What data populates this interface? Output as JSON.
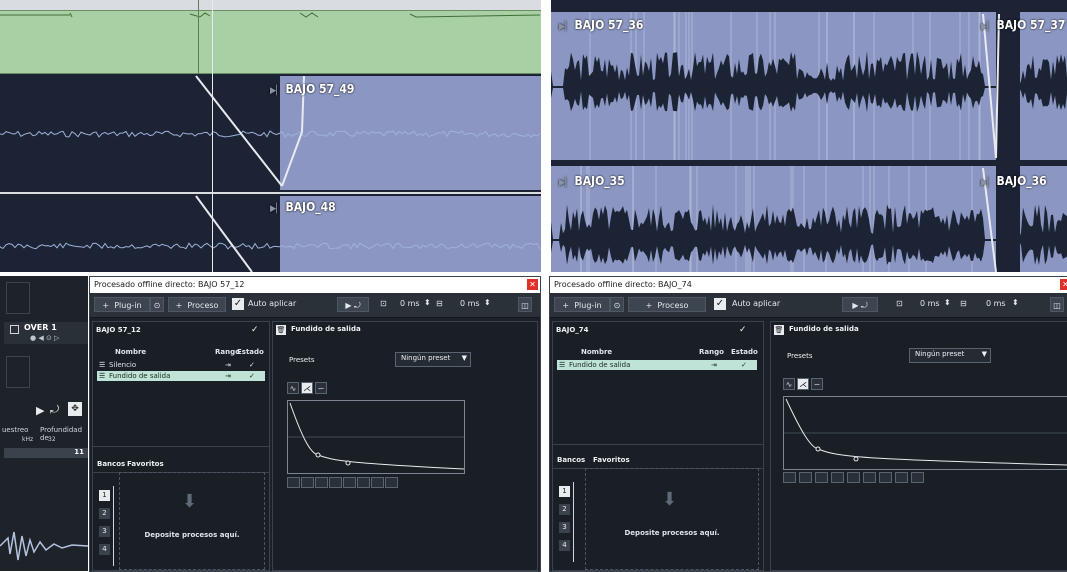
{
  "top_left": {
    "tracks": [
      {
        "label": "BAJO 57_49"
      },
      {
        "label": "BAJO_48"
      }
    ]
  },
  "top_right": {
    "tracks": [
      {
        "label": "BAJO 57_36"
      },
      {
        "label": "BAJO 57_37"
      },
      {
        "label": "BAJO_35"
      },
      {
        "label": "BAJO_36"
      }
    ]
  },
  "mixer_left": {
    "channel_name": "OVER 1",
    "col_headers": [
      "uestreo",
      "Profundidad de"
    ],
    "col_units": [
      "kHz",
      "32"
    ],
    "value": "11"
  },
  "dialogs": [
    {
      "title": "Procesado offline directo: BAJO 57_12",
      "toolbar": {
        "plugin_label": "Plug-in",
        "proceso_label": "Proceso",
        "auto_label": "Auto aplicar",
        "time1": "0 ms",
        "time2": "0 ms"
      },
      "clip_name": "BAJO 57_12",
      "list_headers": {
        "name": "Nombre",
        "range": "Rango",
        "state": "Estado"
      },
      "processes": [
        {
          "name": "Silencio",
          "state": "✓",
          "selected": false
        },
        {
          "name": "Fundido de salida",
          "state": "✓",
          "selected": true
        }
      ],
      "bank_tabs": [
        "Bancos",
        "Favoritos"
      ],
      "slots": [
        "1",
        "2",
        "3",
        "4"
      ],
      "drop_text": "Deposite procesos aquí.",
      "right_title": "Fundido de salida",
      "presets_label": "Presets",
      "preset_value": "Ningún preset"
    },
    {
      "title": "Procesado offline directo: BAJO_74",
      "toolbar": {
        "plugin_label": "Plug-in",
        "proceso_label": "Proceso",
        "auto_label": "Auto aplicar",
        "time1": "0 ms",
        "time2": "0 ms"
      },
      "clip_name": "BAJO_74",
      "list_headers": {
        "name": "Nombre",
        "range": "Rango",
        "state": "Estado"
      },
      "processes": [
        {
          "name": "Fundido de salida",
          "state": "✓",
          "selected": true
        }
      ],
      "bank_tabs": [
        "Bancos",
        "Favoritos"
      ],
      "slots": [
        "1",
        "2",
        "3",
        "4"
      ],
      "drop_text": "Deposite procesos aquí.",
      "right_title": "Fundido de salida",
      "presets_label": "Presets",
      "preset_value": "Ningún preset"
    }
  ],
  "colors": {
    "clip_green": "#a9cfa4",
    "clip_blue": "#8b97c2",
    "clip_dark": "#1b2334",
    "panel_bg": "#1c2127"
  }
}
